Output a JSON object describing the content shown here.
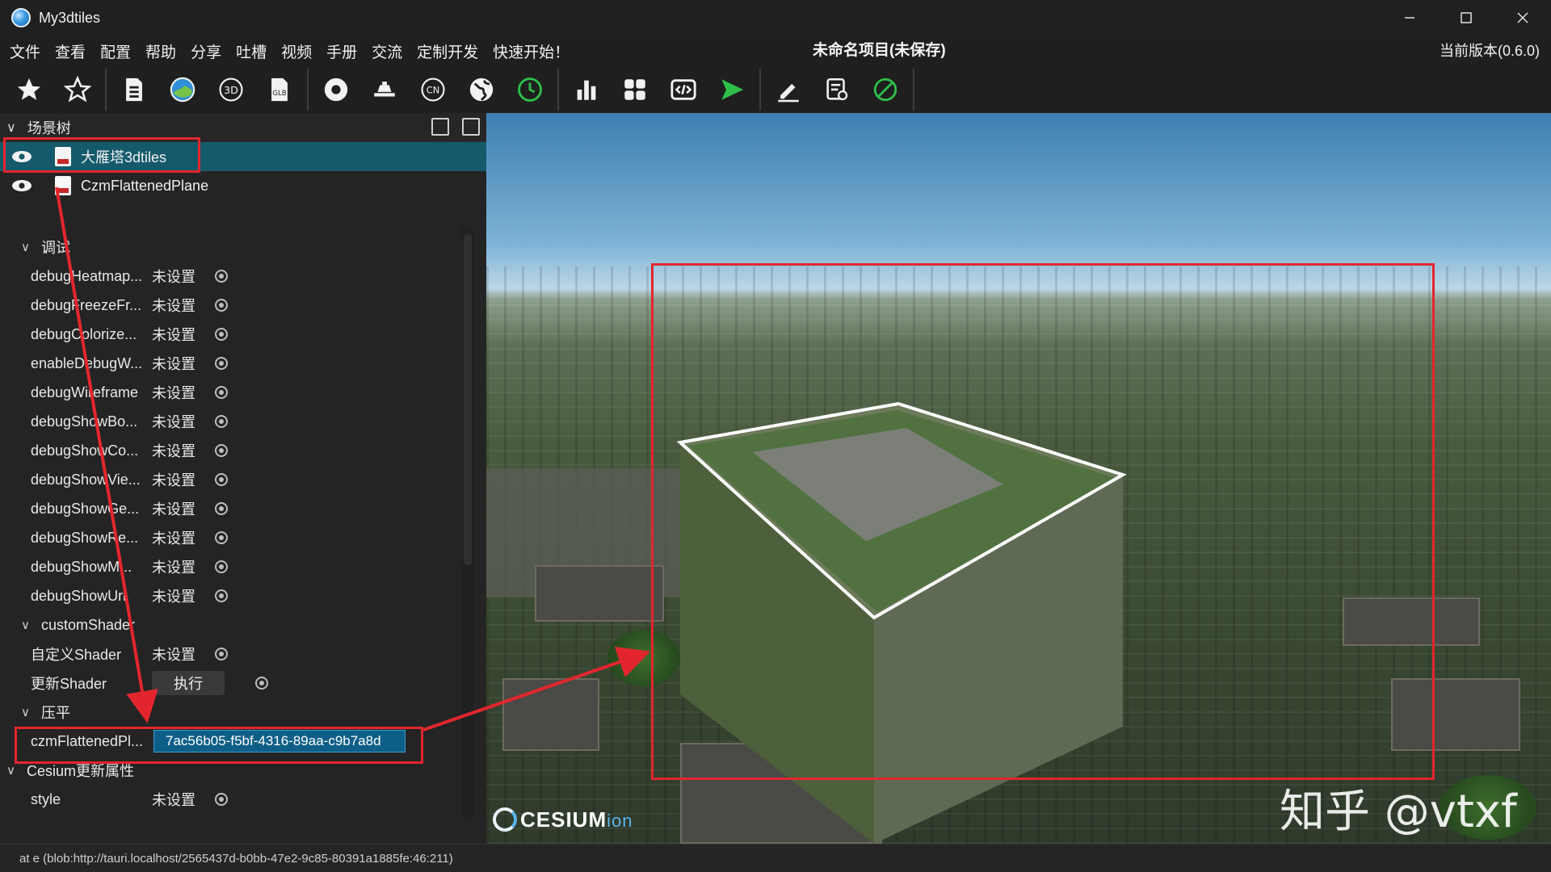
{
  "window": {
    "title": "My3dtiles",
    "controls": [
      "minimize-icon",
      "maximize-icon",
      "close-icon"
    ]
  },
  "menu": {
    "items": [
      "文件",
      "查看",
      "配置",
      "帮助",
      "分享",
      "吐槽",
      "视频",
      "手册",
      "交流",
      "定制开发",
      "快速开始！"
    ],
    "project_title": "未命名项目(未保存)",
    "version": "当前版本(0.6.0)"
  },
  "toolbar": {
    "groups": [
      [
        "star-filled-icon",
        "star-outline-icon",
        "document-icon",
        "globe-image-icon",
        "3d-icon",
        "glb-icon"
      ],
      [
        "record-icon",
        "flatten-icon",
        "cn-icon",
        "earth-icon",
        "clock-icon"
      ],
      [
        "bar-chart-icon",
        "grid-icon",
        "code-icon",
        "play-icon"
      ],
      [
        "edit-icon",
        "settings-doc-icon",
        "disabled-icon"
      ]
    ],
    "colors": {
      "accent_green": "#2fbf4a",
      "default": "#f2f2f2"
    }
  },
  "scene_tree": {
    "title": "场景树",
    "items": [
      {
        "label": "大雁塔3dtiles",
        "selected": true
      },
      {
        "label": "CzmFlattenedPlane",
        "selected": false
      }
    ]
  },
  "properties": {
    "groups": {
      "debug": "调试",
      "custom_shader": "customShader",
      "flatten": "压平",
      "cesium_update": "Cesium更新属性"
    },
    "unset": "未设置",
    "debug_rows": [
      "debugHeatmap...",
      "debugFreezeFr...",
      "debugColorize...",
      "enableDebugW...",
      "debugWireframe",
      "debugShowBo...",
      "debugShowCo...",
      "debugShowVie...",
      "debugShowGe...",
      "debugShowRe...",
      "debugShowM...",
      "debugShowUrl"
    ],
    "custom_shader_rows": {
      "define_label": "自定义Shader",
      "update_label": "更新Shader",
      "execute_label": "执行"
    },
    "flatten_row": {
      "label": "czmFlattenedPl...",
      "value": "7ac56b05-f5bf-4316-89aa-c9b7a8d"
    },
    "style_row": {
      "label": "style"
    }
  },
  "viewport": {
    "logo_text": "CESIUM",
    "logo_suffix": "ion",
    "watermark": "知乎 @vtxf"
  },
  "status": {
    "text": "at e (blob:http://tauri.localhost/2565437d-b0bb-47e2-9c85-80391a1885fe:46:211)"
  },
  "annotation_color": "#e3262e"
}
